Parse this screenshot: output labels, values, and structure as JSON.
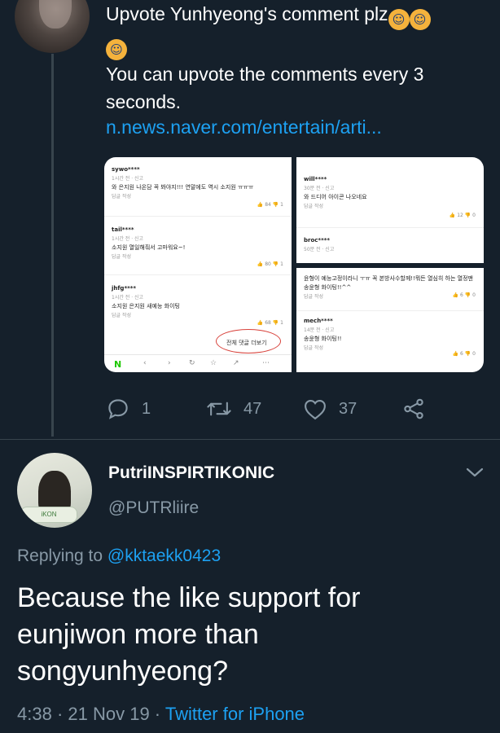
{
  "parent_tweet": {
    "text_line1": "Upvote Yunhyeong's comment plz",
    "emoji": "crying-face",
    "text_line2": "You can upvote the comments every 3 seconds.",
    "link": "n.news.naver.com/entertain/arti...",
    "media": {
      "left_panel": {
        "comments": [
          {
            "user": "sywo****",
            "meta": "1시간 전 · 신고",
            "text": "와 은지원 나온담 꼭 봐야지!!! 연말에도 역시 소지원 ㅠㅠㅠ",
            "reply": "답글 작성",
            "likes": "84",
            "dislikes": "1"
          },
          {
            "user": "tail****",
            "meta": "1시간 전 · 신고",
            "text": "소지원 열일해줘서 고마워요~!",
            "reply": "답글 작성",
            "likes": "80",
            "dislikes": "1"
          },
          {
            "user": "jhfg****",
            "meta": "1시간 전 · 신고",
            "text": "소지원 은지원 새예능 화이팅",
            "reply": "답글 작성",
            "likes": "68",
            "dislikes": "1"
          }
        ],
        "more_comments": "전체 댓글 더보기",
        "nav_logo": "N"
      },
      "right_top_panel": {
        "comments": [
          {
            "user": "will****",
            "meta": "30분 전 · 신고",
            "text": "와 드디어 아이콘 나오네요",
            "reply": "답글 작성",
            "likes": "12",
            "dislikes": "0"
          },
          {
            "user": "broc****",
            "meta": "50분 전 · 신고",
            "text": "",
            "reply": "",
            "likes": "",
            "dislikes": ""
          }
        ]
      },
      "right_bottom_panel": {
        "comments": [
          {
            "user": "",
            "meta": "",
            "text": "윤형이 예능고정이라니 ㅜㅠ 꼭 본방사수할께!!뭐든 열심히 하는 열정맨 송윤형 화이팅!!^^",
            "reply": "답글 작성",
            "likes": "6",
            "dislikes": "0"
          },
          {
            "user": "mech****",
            "meta": "14분 전 · 신고",
            "text": "송윤형 화이팅!!",
            "reply": "답글 작성",
            "likes": "6",
            "dislikes": "0"
          }
        ]
      }
    },
    "actions": {
      "reply_count": "1",
      "retweet_count": "47",
      "like_count": "37"
    }
  },
  "main_tweet": {
    "display_name": "PutriINSPIRTIKONIC",
    "handle": "@PUTRliire",
    "replying_prefix": "Replying to",
    "replying_to": "@kktaekk0423",
    "text": "Because the like support for eunjiwon more than songyunhyeong?",
    "time": "4:38",
    "date": "21 Nov 19",
    "source": "Twitter for iPhone"
  },
  "colors": {
    "background": "#15202b",
    "link": "#1da1f2",
    "muted": "#8899a6",
    "divider": "#38444d"
  }
}
